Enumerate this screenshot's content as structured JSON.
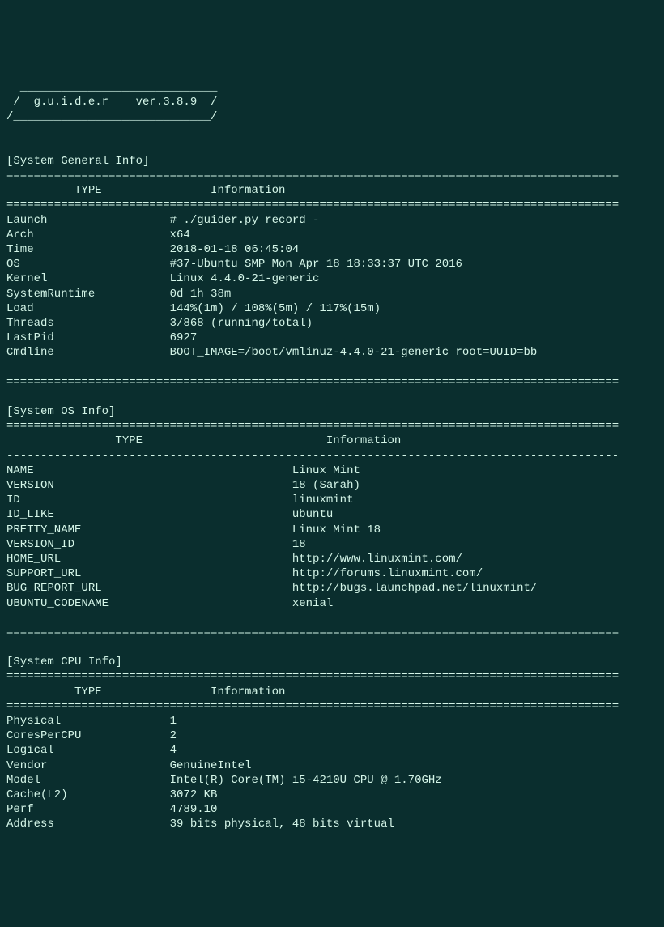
{
  "banner": {
    "top": "  _____________________________",
    "mid": " /  g.u.i.d.e.r    ver.3.8.9  /",
    "bot": "/_____________________________/"
  },
  "sections": {
    "general": {
      "title": "[System General Info]",
      "hdrType": "TYPE",
      "hdrInfo": "Information",
      "rows": [
        {
          "k": "Launch",
          "v": "# ./guider.py record -"
        },
        {
          "k": "Arch",
          "v": "x64"
        },
        {
          "k": "Time",
          "v": "2018-01-18 06:45:04"
        },
        {
          "k": "OS",
          "v": "#37-Ubuntu SMP Mon Apr 18 18:33:37 UTC 2016"
        },
        {
          "k": "Kernel",
          "v": "Linux 4.4.0-21-generic"
        },
        {
          "k": "SystemRuntime",
          "v": "0d 1h 38m"
        },
        {
          "k": "Load",
          "v": "144%(1m) / 108%(5m) / 117%(15m)"
        },
        {
          "k": "Threads",
          "v": "3/868 (running/total)"
        },
        {
          "k": "LastPid",
          "v": "6927"
        },
        {
          "k": "Cmdline",
          "v": "BOOT_IMAGE=/boot/vmlinuz-4.4.0-21-generic root=UUID=bb"
        }
      ]
    },
    "os": {
      "title": "[System OS Info]",
      "hdrType": "TYPE",
      "hdrInfo": "Information",
      "rows": [
        {
          "k": "NAME",
          "v": "Linux Mint"
        },
        {
          "k": "VERSION",
          "v": "18 (Sarah)"
        },
        {
          "k": "ID",
          "v": "linuxmint"
        },
        {
          "k": "ID_LIKE",
          "v": "ubuntu"
        },
        {
          "k": "PRETTY_NAME",
          "v": "Linux Mint 18"
        },
        {
          "k": "VERSION_ID",
          "v": "18"
        },
        {
          "k": "HOME_URL",
          "v": "http://www.linuxmint.com/"
        },
        {
          "k": "SUPPORT_URL",
          "v": "http://forums.linuxmint.com/"
        },
        {
          "k": "BUG_REPORT_URL",
          "v": "http://bugs.launchpad.net/linuxmint/"
        },
        {
          "k": "UBUNTU_CODENAME",
          "v": "xenial"
        }
      ]
    },
    "cpu": {
      "title": "[System CPU Info]",
      "hdrType": "TYPE",
      "hdrInfo": "Information",
      "rows": [
        {
          "k": "Physical",
          "v": "1"
        },
        {
          "k": "CoresPerCPU",
          "v": "2"
        },
        {
          "k": "Logical",
          "v": "4"
        },
        {
          "k": "Vendor",
          "v": "GenuineIntel"
        },
        {
          "k": "Model",
          "v": "Intel(R) Core(TM) i5-4210U CPU @ 1.70GHz"
        },
        {
          "k": "Cache(L2)",
          "v": "3072 KB"
        },
        {
          "k": "Perf",
          "v": "4789.10"
        },
        {
          "k": "Address",
          "v": "39 bits physical, 48 bits virtual"
        }
      ]
    }
  },
  "layout": {
    "cols": 90,
    "generalValCol": 24,
    "osValCol": 42,
    "cpuValCol": 24,
    "generalTypeCenter": 12,
    "generalInfoCenter": 35,
    "osTypeCenter": 18,
    "osInfoCenter": 52,
    "cpuTypeCenter": 12,
    "cpuInfoCenter": 35
  }
}
